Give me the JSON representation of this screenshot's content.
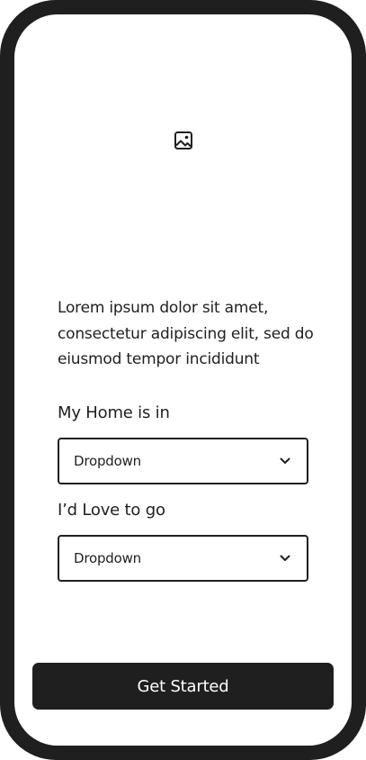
{
  "hero": {
    "icon": "image-placeholder-icon"
  },
  "intro": {
    "text": "Lorem ipsum dolor sit amet, consectetur adipiscing elit, sed do eiusmod tempor incididunt"
  },
  "form": {
    "home": {
      "label": "My Home is in",
      "value": "Dropdown",
      "icon": "chevron-down-icon"
    },
    "destination": {
      "label": "I’d Love to go",
      "value": "Dropdown",
      "icon": "chevron-down-icon"
    }
  },
  "actions": {
    "primary_label": "Get Started"
  },
  "colors": {
    "frame": "#1f1f1f",
    "screen": "#ffffff",
    "text": "#1f1f1f",
    "button_bg": "#1f1f1f",
    "button_text": "#ffffff"
  }
}
